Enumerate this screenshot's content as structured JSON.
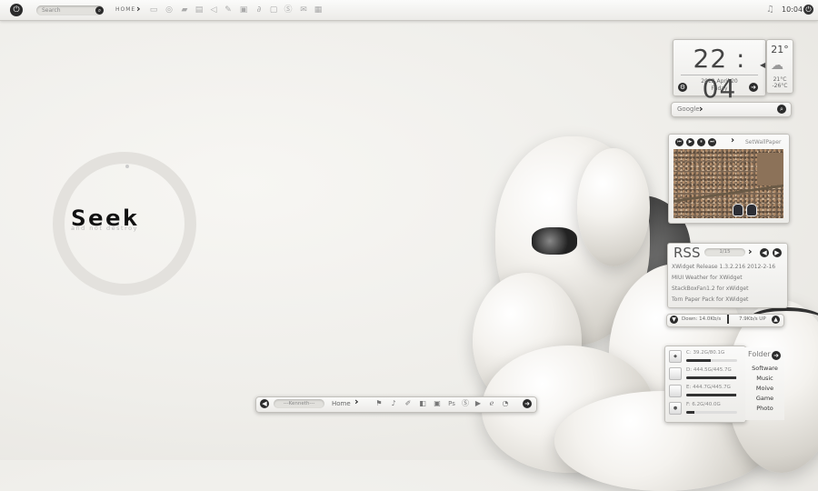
{
  "topbar": {
    "search_placeholder": "Search",
    "home_label": "HOME",
    "time": "10:04",
    "quick_icons": [
      "monitor-icon",
      "globe-icon",
      "chat-icon",
      "folder-icon",
      "speaker-icon",
      "edit-icon",
      "image-icon",
      "paperclip-icon",
      "lock-icon",
      "skype-icon",
      "mail-icon",
      "box-icon"
    ]
  },
  "logo": {
    "title": "Seek",
    "subtitle": "and not destroy"
  },
  "clock": {
    "time": "22 : 04",
    "date": "2012  April  20",
    "day": "Friday"
  },
  "weather": {
    "temp": "21°",
    "high": "21°C",
    "low": "-26°C",
    "icon": "partly-cloudy-icon"
  },
  "google": {
    "label": "Google"
  },
  "photo": {
    "label": "SetWallPaper"
  },
  "rss": {
    "title": "RSS",
    "pager": "1/15",
    "items": [
      "XWidget Release 1.3.2.216   2012-2-16",
      "MIUI Weather for XWidget",
      "StackBoxFan1.2 for xWidget",
      "Torn Paper Pack for XWidget"
    ]
  },
  "network": {
    "down": "Down: 14.0Kb/s",
    "up": "7.9Kb/s UP"
  },
  "drives": [
    {
      "label": "C:  39.2G/80.1G",
      "fill": 0.49
    },
    {
      "label": "D:  444.5G/445.7G",
      "fill": 0.99
    },
    {
      "label": "E:  444.7G/445.7G",
      "fill": 0.99
    },
    {
      "label": "F:  6.2G/40.0G",
      "fill": 0.16
    }
  ],
  "folder": {
    "title": "Folder",
    "items": [
      "Software",
      "Music",
      "Moive",
      "Game",
      "Photo"
    ]
  },
  "dock": {
    "user": "---Kenneth---",
    "home": "Home",
    "icons": [
      "flag-icon",
      "music-icon",
      "paint-icon",
      "cube-icon",
      "lock-icon",
      "camera-icon",
      "photoshop-icon",
      "skype-icon",
      "play-icon",
      "ie-icon",
      "chrome-icon"
    ],
    "ps_label": "Ps"
  }
}
